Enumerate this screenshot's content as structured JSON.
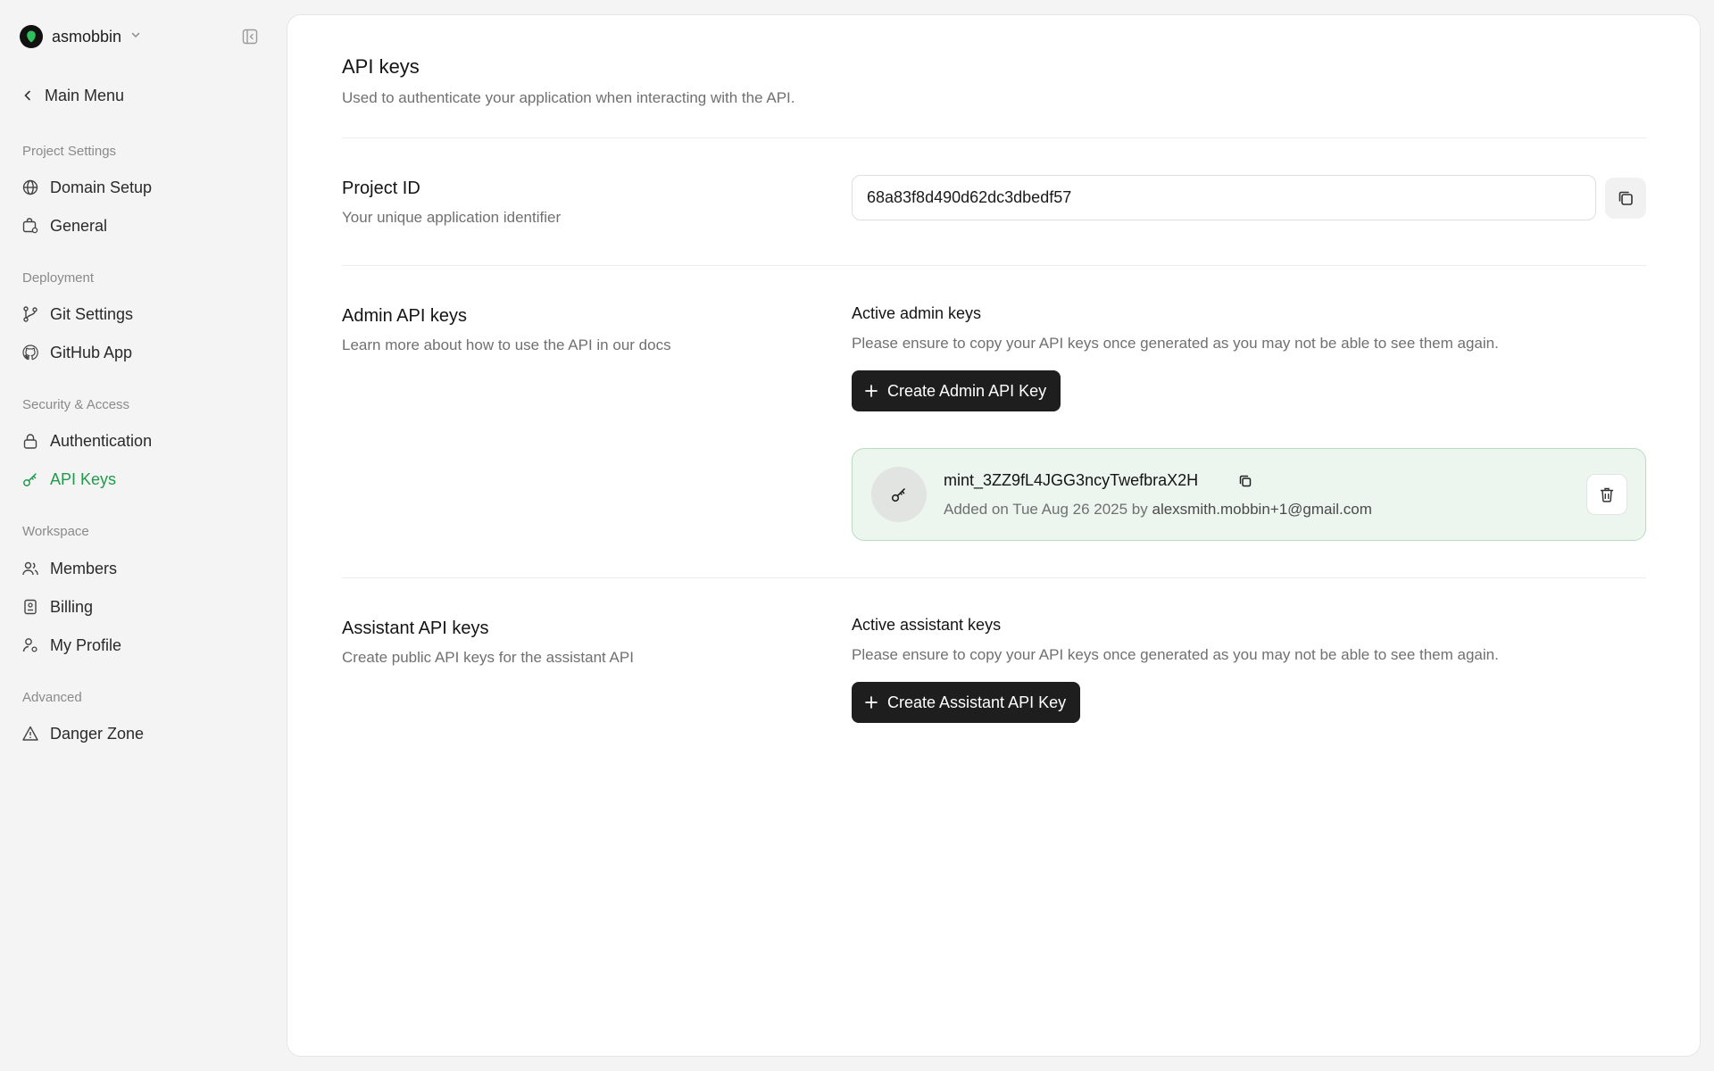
{
  "workspace": {
    "name": "asmobbin"
  },
  "nav": {
    "main_menu": "Main Menu",
    "groups": [
      {
        "label": "Project Settings",
        "items": [
          {
            "label": "Domain Setup",
            "icon": "globe-icon"
          },
          {
            "label": "General",
            "icon": "settings-bag-icon"
          }
        ]
      },
      {
        "label": "Deployment",
        "items": [
          {
            "label": "Git Settings",
            "icon": "git-branch-icon"
          },
          {
            "label": "GitHub App",
            "icon": "github-icon"
          }
        ]
      },
      {
        "label": "Security & Access",
        "items": [
          {
            "label": "Authentication",
            "icon": "lock-icon"
          },
          {
            "label": "API Keys",
            "icon": "key-icon",
            "active": true
          }
        ]
      },
      {
        "label": "Workspace",
        "items": [
          {
            "label": "Members",
            "icon": "users-icon"
          },
          {
            "label": "Billing",
            "icon": "receipt-icon"
          },
          {
            "label": "My Profile",
            "icon": "user-gear-icon"
          }
        ]
      },
      {
        "label": "Advanced",
        "items": [
          {
            "label": "Danger Zone",
            "icon": "warning-icon"
          }
        ]
      }
    ],
    "active_color": "#1f9a4b"
  },
  "page": {
    "title": "API keys",
    "subtitle": "Used to authenticate your application when interacting with the API."
  },
  "project": {
    "title": "Project ID",
    "subtitle": "Your unique application identifier",
    "value": "68a83f8d490d62dc3dbedf57"
  },
  "admin": {
    "title": "Admin API keys",
    "subtitle": "Learn more about how to use the API in our docs",
    "active_label": "Active admin keys",
    "note": "Please ensure to copy your API keys once generated as you may not be able to see them again.",
    "create_label": "Create Admin API Key",
    "keys": [
      {
        "name": "mint_3ZZ9fL4JGG3ncyTwefbraX2H",
        "added_prefix": "Added on Tue Aug 26 2025 by",
        "email": "alexsmith.mobbin+1@gmail.com"
      }
    ]
  },
  "assistant": {
    "title": "Assistant API keys",
    "subtitle": "Create public API keys for the assistant API",
    "active_label": "Active assistant keys",
    "note": "Please ensure to copy your API keys once generated as you may not be able to see them again.",
    "create_label": "Create Assistant API Key"
  }
}
